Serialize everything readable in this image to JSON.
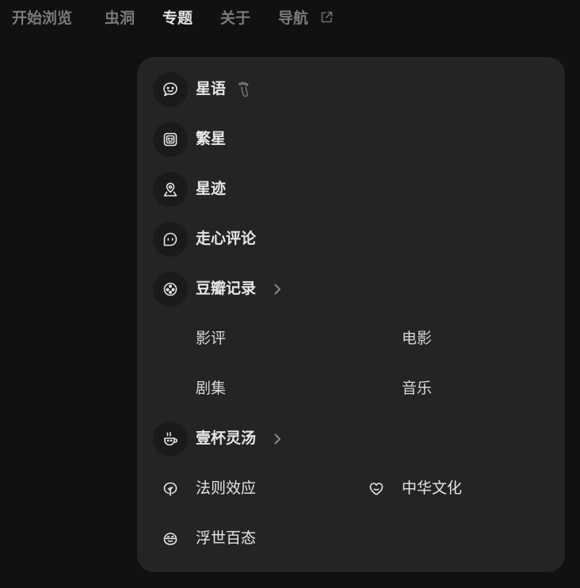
{
  "nav": {
    "items": [
      {
        "label": "开始浏览",
        "active": false
      },
      {
        "label": "虫洞",
        "active": false
      },
      {
        "label": "专题",
        "active": true
      },
      {
        "label": "关于",
        "active": false
      },
      {
        "label": "导航",
        "active": false
      }
    ],
    "external_icon": "external-link-icon"
  },
  "dropdown": {
    "items": [
      {
        "label": "星语",
        "icon": "chat-smile-icon",
        "badge_icon": "footprint-icon"
      },
      {
        "label": "繁星",
        "icon": "photo-frame-icon"
      },
      {
        "label": "星迹",
        "icon": "map-pin-icon"
      },
      {
        "label": "走心评论",
        "icon": "comment-icon"
      },
      {
        "label": "豆瓣记录",
        "icon": "film-reel-icon",
        "has_submenu": true,
        "children": [
          "影评",
          "电影",
          "剧集",
          "音乐"
        ]
      },
      {
        "label": "壹杯灵汤",
        "icon": "cup-icon",
        "has_submenu": true
      },
      {
        "label": "法则效应",
        "icon": "leaf-icon"
      },
      {
        "label": "中华文化",
        "icon": "heart-icon"
      },
      {
        "label": "浮世百态",
        "icon": "face-icon"
      }
    ]
  },
  "colors": {
    "background": "#111111",
    "panel": "#242424",
    "icon_circle": "#1a1a1a",
    "nav_active": "#e2e2e2",
    "nav_inactive": "#7a7a7a"
  }
}
